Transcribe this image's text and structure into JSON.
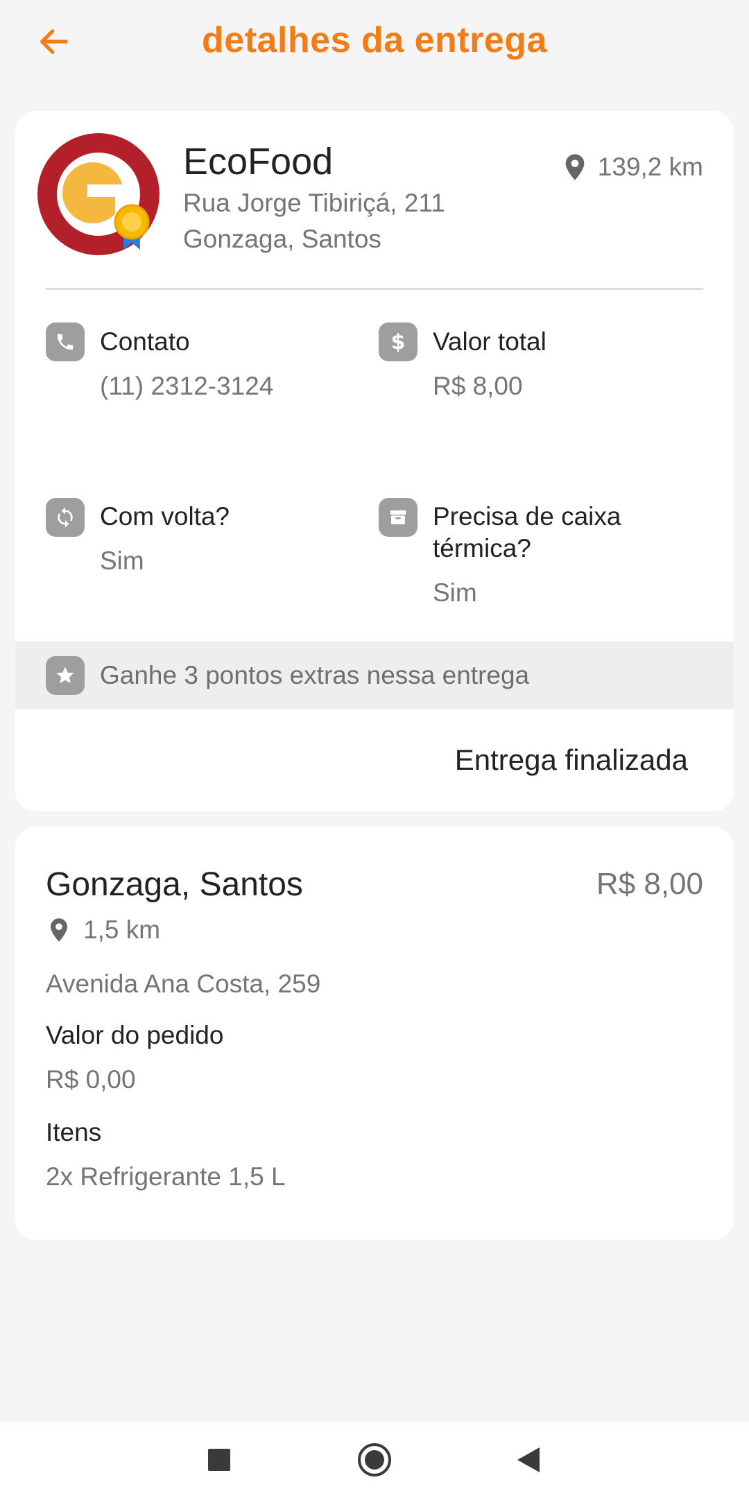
{
  "header": {
    "title": "detalhes da entrega",
    "back_icon": "arrow-left-icon",
    "accent_color": "#f07d16"
  },
  "store": {
    "name": "EcoFood",
    "address_line1": "Rua Jorge Tibiriçá, 211",
    "address_line2": "Gonzaga, Santos",
    "distance": "139,2 km",
    "logo_icon": "store-logo-with-medal",
    "logo_text": "G",
    "logo_colors": {
      "ring": "#b3202a",
      "inner": "#f4b740",
      "medal": "#f6b900",
      "ribbon": "#2f7ad8"
    }
  },
  "info": {
    "contact": {
      "label": "Contato",
      "value": "(11) 2312-3124",
      "icon": "phone-icon"
    },
    "total": {
      "label": "Valor total",
      "value": "R$ 8,00",
      "icon": "dollar-icon"
    },
    "return_trip": {
      "label": "Com volta?",
      "value": "Sim",
      "icon": "sync-icon"
    },
    "thermal_box": {
      "label_line1": "Precisa de caixa",
      "label_line2": "térmica?",
      "value": "Sim",
      "icon": "box-icon"
    }
  },
  "points_banner": {
    "text": "Ganhe 3 pontos extras nessa entrega",
    "icon": "star-icon"
  },
  "status": {
    "text": "Entrega finalizada"
  },
  "destination": {
    "name": "Gonzaga, Santos",
    "price": "R$ 8,00",
    "distance": "1,5 km",
    "address": "Avenida Ana Costa, 259",
    "order_value_label": "Valor do pedido",
    "order_value": "R$ 0,00",
    "items_label": "Itens",
    "items": "2x Refrigerante 1,5 L"
  },
  "navbar": {
    "recents_icon": "square-icon",
    "home_icon": "circle-home-icon",
    "back_icon": "triangle-back-icon"
  }
}
